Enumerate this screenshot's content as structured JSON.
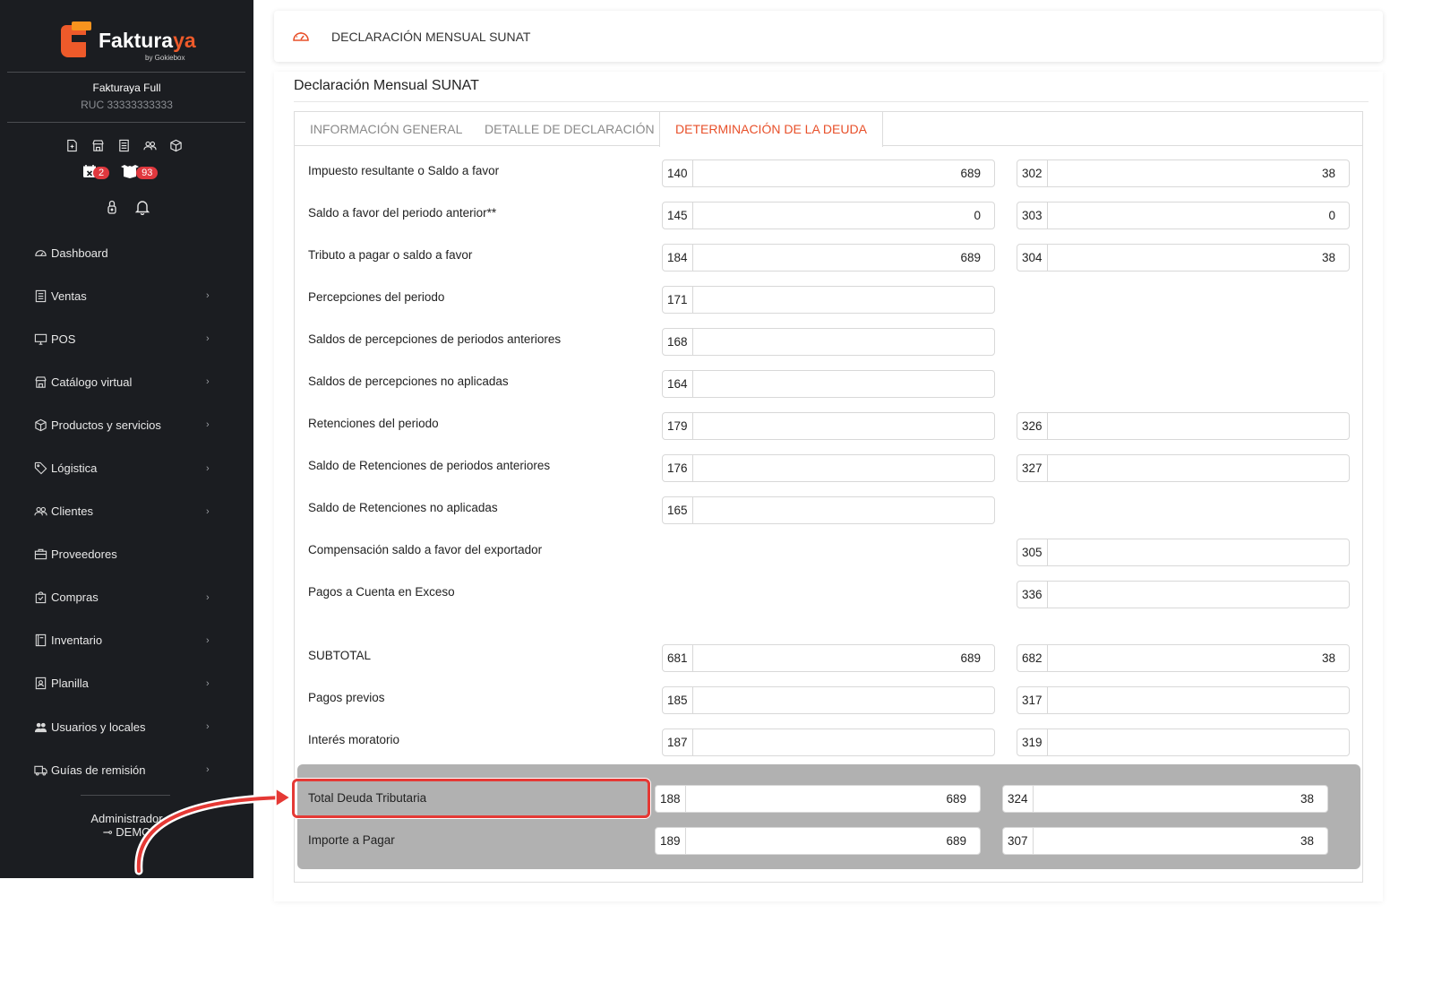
{
  "sidebar": {
    "logo_text_main": "Faktura",
    "logo_text_accent": "ya",
    "logo_by": "by Gokiebox",
    "company_name": "Fakturaya Full",
    "ruc": "RUC 33333333333",
    "badge_calendar": "2",
    "badge_boxes": "93",
    "menu": [
      {
        "label": "Dashboard",
        "icon": "dashboard-icon",
        "chevron": ""
      },
      {
        "label": "Ventas",
        "icon": "receipt-icon",
        "chevron": "›"
      },
      {
        "label": "POS",
        "icon": "monitor-icon",
        "chevron": "›"
      },
      {
        "label": "Catálogo virtual",
        "icon": "store-icon",
        "chevron": "›"
      },
      {
        "label": "Productos y servicios",
        "icon": "box-icon",
        "chevron": "›"
      },
      {
        "label": "Lógistica",
        "icon": "tag-icon",
        "chevron": "›"
      },
      {
        "label": "Clientes",
        "icon": "users-icon",
        "chevron": "›"
      },
      {
        "label": "Proveedores",
        "icon": "briefcase-icon",
        "chevron": ""
      },
      {
        "label": "Compras",
        "icon": "bag-icon",
        "chevron": "›"
      },
      {
        "label": "Inventario",
        "icon": "book-icon",
        "chevron": "›"
      },
      {
        "label": "Planilla",
        "icon": "id-card-icon",
        "chevron": "›"
      },
      {
        "label": "Usuarios y locales",
        "icon": "user-group-icon",
        "chevron": "›"
      },
      {
        "label": "Guías de remisión",
        "icon": "truck-icon",
        "chevron": "›"
      }
    ],
    "user_role": "Administrador",
    "user_name": "DEMO"
  },
  "header": {
    "title": "DECLARACIÓN MENSUAL SUNAT",
    "icon": "gauge-icon"
  },
  "main": {
    "page_title": "Declaración Mensual SUNAT",
    "tabs": [
      {
        "label": "INFORMACIÓN GENERAL",
        "active": false
      },
      {
        "label": "DETALLE DE DECLARACIÓN",
        "active": false
      },
      {
        "label": "DETERMINACIÓN DE LA DEUDA",
        "active": true
      }
    ],
    "rows": [
      {
        "label": "Impuesto resultante o Saldo a favor",
        "left": {
          "code": "140",
          "value": "689"
        },
        "right": {
          "code": "302",
          "value": "38"
        }
      },
      {
        "label": "Saldo a favor del periodo anterior**",
        "left": {
          "code": "145",
          "value": "0"
        },
        "right": {
          "code": "303",
          "value": "0"
        }
      },
      {
        "label": "Tributo a pagar o saldo a favor",
        "left": {
          "code": "184",
          "value": "689"
        },
        "right": {
          "code": "304",
          "value": "38"
        }
      },
      {
        "label": "Percepciones del periodo",
        "left": {
          "code": "171",
          "value": ""
        }
      },
      {
        "label": "Saldos de percepciones de periodos anteriores",
        "left": {
          "code": "168",
          "value": ""
        }
      },
      {
        "label": "Saldos de percepciones no aplicadas",
        "left": {
          "code": "164",
          "value": ""
        }
      },
      {
        "label": "Retenciones del periodo",
        "left": {
          "code": "179",
          "value": ""
        },
        "right": {
          "code": "326",
          "value": ""
        }
      },
      {
        "label": "Saldo de Retenciones de periodos anteriores",
        "left": {
          "code": "176",
          "value": ""
        },
        "right": {
          "code": "327",
          "value": ""
        }
      },
      {
        "label": "Saldo de Retenciones no aplicadas",
        "left": {
          "code": "165",
          "value": ""
        }
      },
      {
        "label": "Compensación saldo a favor del exportador",
        "right": {
          "code": "305",
          "value": ""
        }
      },
      {
        "label": "Pagos a Cuenta en Exceso",
        "right": {
          "code": "336",
          "value": ""
        }
      },
      {
        "label": "SUBTOTAL",
        "left": {
          "code": "681",
          "value": "689"
        },
        "right": {
          "code": "682",
          "value": "38"
        }
      },
      {
        "label": "Pagos previos",
        "left": {
          "code": "185",
          "value": ""
        },
        "right": {
          "code": "317",
          "value": ""
        }
      },
      {
        "label": "Interés moratorio",
        "left": {
          "code": "187",
          "value": ""
        },
        "right": {
          "code": "319",
          "value": ""
        }
      }
    ],
    "totals": [
      {
        "label": "Total Deuda Tributaria",
        "left": {
          "code": "188",
          "value": "689"
        },
        "right": {
          "code": "324",
          "value": "38"
        },
        "highlighted": true
      },
      {
        "label": "Importe a Pagar",
        "left": {
          "code": "189",
          "value": "689"
        },
        "right": {
          "code": "307",
          "value": "38"
        }
      }
    ]
  },
  "colors": {
    "accent": "#e8502a",
    "sidebar_bg": "#1b1d21",
    "badge": "#e0383e",
    "highlight": "#e53935",
    "totals_bg": "#b1b1b1"
  }
}
